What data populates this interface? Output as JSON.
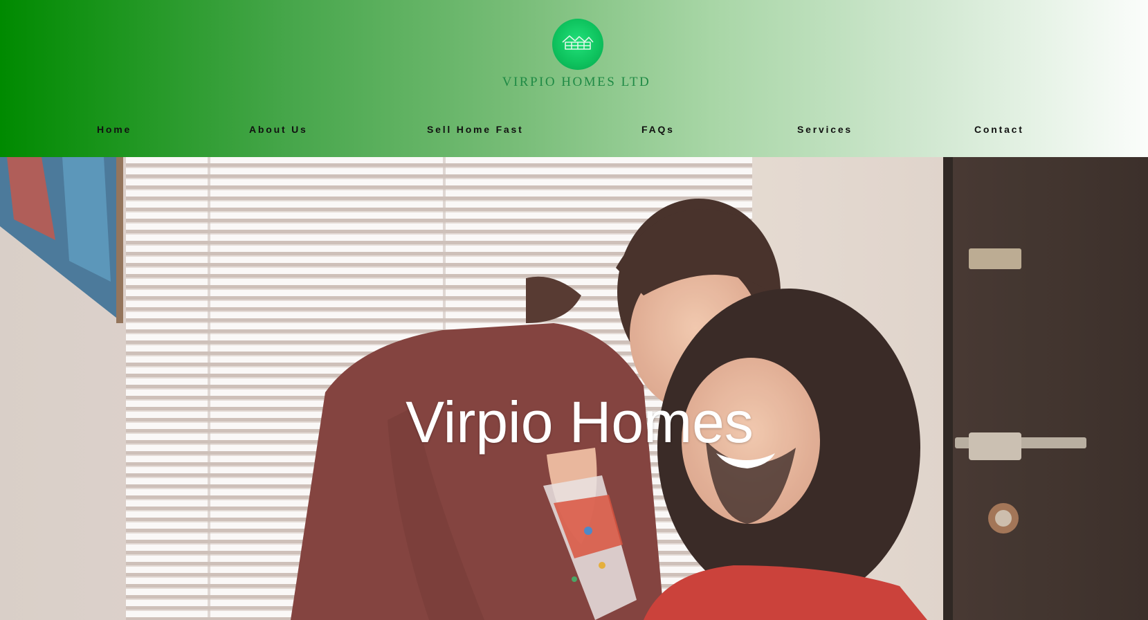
{
  "brand": {
    "logo_icon": "house-roof-icon",
    "name": "VIRPIO HOMES LTD",
    "accent": "#0fc45f"
  },
  "nav": {
    "items": [
      {
        "label": "Home"
      },
      {
        "label": "About Us"
      },
      {
        "label": "Sell Home Fast"
      },
      {
        "label": "FAQs"
      },
      {
        "label": "Services"
      },
      {
        "label": "Contact"
      }
    ]
  },
  "hero": {
    "title": "Virpio Homes",
    "image": "couple-smiling-in-home-photo"
  },
  "colors": {
    "header_gradient_start": "#008a00",
    "header_gradient_end": "#fbfdfb",
    "nav_text": "#111111",
    "hero_title": "#ffffff"
  }
}
